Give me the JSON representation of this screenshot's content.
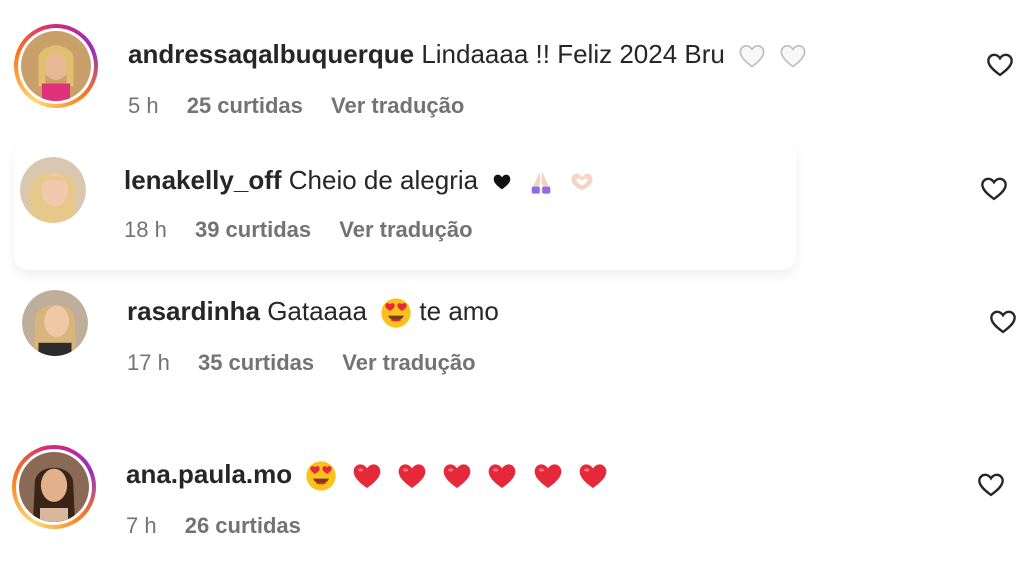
{
  "comments": [
    {
      "username": "andressaqalbuquerque",
      "text": "Lindaaaa !! Feliz 2024 Bru",
      "emojis": [
        "white-heart",
        "white-heart"
      ],
      "time": "5 h",
      "likes": "25 curtidas",
      "translate": "Ver tradução"
    },
    {
      "username": "lenakelly_off",
      "text": "Cheio de alegria",
      "emojis": [
        "black-heart",
        "praying-hands",
        "heart-hands"
      ],
      "time": "18 h",
      "likes": "39 curtidas",
      "translate": "Ver tradução"
    },
    {
      "username": "rasardinha",
      "text": "Gataaaa",
      "text_after": "te amo",
      "emojis": [
        "heart-eyes"
      ],
      "time": "17 h",
      "likes": "35 curtidas",
      "translate": "Ver tradução"
    },
    {
      "username": "ana.paula.mo",
      "text": "",
      "emojis": [
        "heart-eyes",
        "red-heart",
        "red-heart",
        "red-heart",
        "red-heart",
        "red-heart",
        "red-heart"
      ],
      "time": "7 h",
      "likes": "26 curtidas"
    }
  ],
  "colors": {
    "text": "#262626",
    "meta": "#737373",
    "red": "#e5283a"
  }
}
